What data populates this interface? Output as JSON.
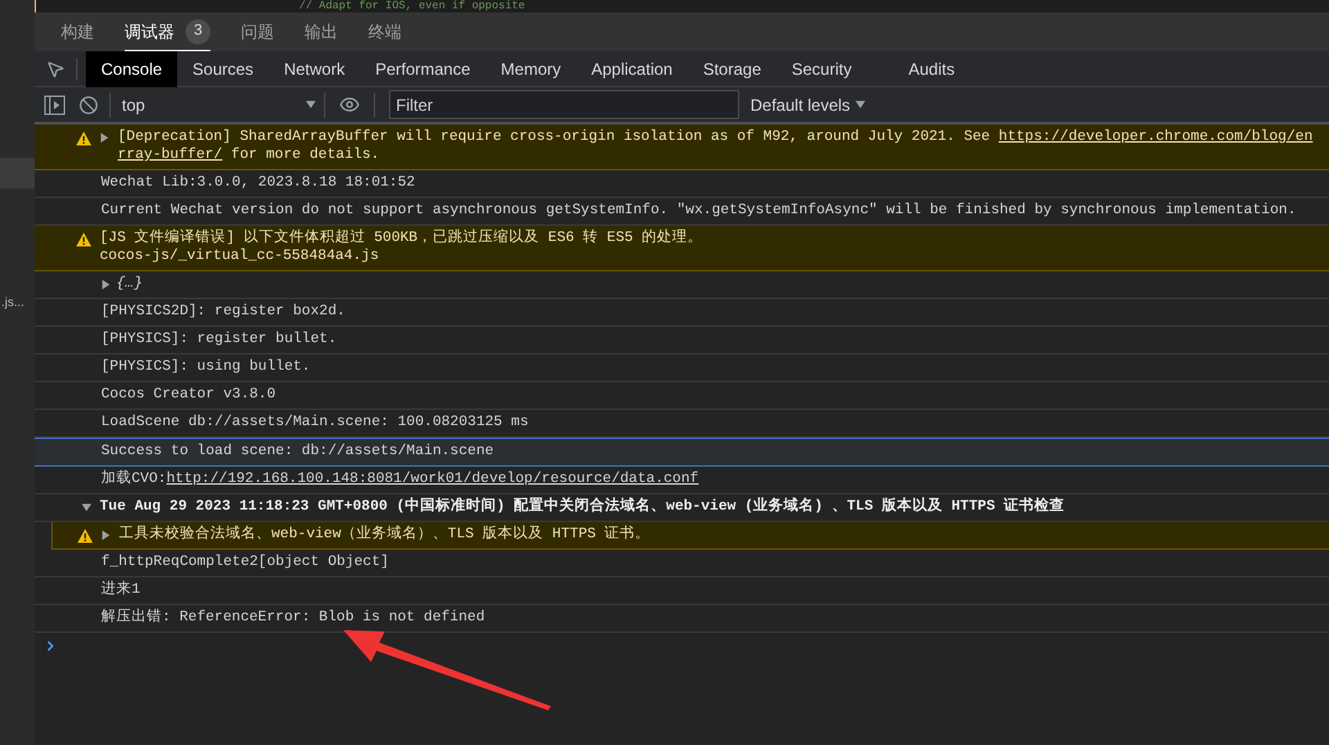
{
  "editor_line": "// Adapt for IOS, even if opposite",
  "sidebar": {
    "file_label": ".js..."
  },
  "panel_tabs": [
    {
      "label": "构建",
      "selected": false
    },
    {
      "label": "调试器",
      "selected": true,
      "badge": "3"
    },
    {
      "label": "问题",
      "selected": false
    },
    {
      "label": "输出",
      "selected": false
    },
    {
      "label": "终端",
      "selected": false
    }
  ],
  "devtools_tabs": [
    {
      "label": "Console",
      "selected": true
    },
    {
      "label": "Sources",
      "selected": false
    },
    {
      "label": "Network",
      "selected": false
    },
    {
      "label": "Performance",
      "selected": false
    },
    {
      "label": "Memory",
      "selected": false
    },
    {
      "label": "Application",
      "selected": false
    },
    {
      "label": "Storage",
      "selected": false
    },
    {
      "label": "Security",
      "selected": false
    },
    {
      "label": "Audits",
      "selected": false
    }
  ],
  "toolbar": {
    "context": "top",
    "filter_placeholder": "Filter",
    "levels": "Default levels"
  },
  "messages": [
    {
      "kind": "warning",
      "selected": false,
      "expandable": true,
      "lines": [
        [
          {
            "text": "[Deprecation] SharedArrayBuffer will require cross-origin isolation as of M92, around July 2021. See ",
            "link": false
          },
          {
            "text": "https://developer.chrome.com/blog/en",
            "link": true
          }
        ],
        [
          {
            "text": "rray-buffer/",
            "link": true
          },
          {
            "text": " for more details.",
            "link": false
          }
        ]
      ]
    },
    {
      "kind": "log",
      "selected": false,
      "lines": [
        [
          {
            "text": "Wechat Lib:3.0.0, 2023.8.18 18:01:52",
            "link": false
          }
        ]
      ]
    },
    {
      "kind": "log",
      "selected": false,
      "lines": [
        [
          {
            "text": "Current Wechat version do not support asynchronous getSystemInfo. \"wx.getSystemInfoAsync\" will be finished by synchronous implementation.",
            "link": false
          }
        ]
      ]
    },
    {
      "kind": "warning",
      "selected": false,
      "expandable": false,
      "lines": [
        [
          {
            "text": "[JS 文件编译错误] 以下文件体积超过 500KB，已跳过压缩以及 ES6 转 ES5 的处理。",
            "link": false
          }
        ],
        [
          {
            "text": "cocos-js/_virtual_cc-558484a4.js",
            "link": false
          }
        ]
      ]
    },
    {
      "kind": "object",
      "selected": false,
      "expanded": false,
      "lines": [
        [
          {
            "text": "{…}",
            "link": false
          }
        ]
      ]
    },
    {
      "kind": "log",
      "selected": false,
      "lines": [
        [
          {
            "text": "[PHYSICS2D]: register box2d.",
            "link": false
          }
        ]
      ]
    },
    {
      "kind": "log",
      "selected": false,
      "lines": [
        [
          {
            "text": "[PHYSICS]: register bullet.",
            "link": false
          }
        ]
      ]
    },
    {
      "kind": "log",
      "selected": false,
      "lines": [
        [
          {
            "text": "[PHYSICS]: using bullet.",
            "link": false
          }
        ]
      ]
    },
    {
      "kind": "log",
      "selected": false,
      "lines": [
        [
          {
            "text": "Cocos Creator v3.8.0",
            "link": false
          }
        ]
      ]
    },
    {
      "kind": "log",
      "selected": false,
      "lines": [
        [
          {
            "text": "LoadScene db://assets/Main.scene: 100.08203125 ms",
            "link": false
          }
        ]
      ]
    },
    {
      "kind": "log",
      "selected": true,
      "lines": [
        [
          {
            "text": "Success to load scene: db://assets/Main.scene",
            "link": false
          }
        ]
      ]
    },
    {
      "kind": "log",
      "selected": false,
      "lines": [
        [
          {
            "text": "加载CVO:",
            "link": false
          },
          {
            "text": "http://192.168.100.148:8081/work01/develop/resource/data.conf",
            "link": true
          }
        ]
      ]
    },
    {
      "kind": "group",
      "selected": false,
      "expanded": true,
      "lines": [
        [
          {
            "text": "Tue Aug 29 2023 11:18:23 GMT+0800 (中国标准时间) 配置中关闭合法域名、web-view (业务域名) 、TLS 版本以及 HTTPS 证书检查",
            "link": false
          }
        ]
      ],
      "children": [
        {
          "kind": "warning",
          "selected": false,
          "expandable": true,
          "lines": [
            [
              {
                "text": "工具未校验合法域名、web-view（业务域名）、TLS 版本以及 HTTPS 证书。",
                "link": false
              }
            ]
          ]
        }
      ]
    },
    {
      "kind": "log",
      "selected": false,
      "lines": [
        [
          {
            "text": "f_httpReqComplete2[object Object]",
            "link": false
          }
        ]
      ]
    },
    {
      "kind": "log",
      "selected": false,
      "lines": [
        [
          {
            "text": "进来1",
            "link": false
          }
        ]
      ]
    },
    {
      "kind": "log",
      "selected": false,
      "lines": [
        [
          {
            "text": "解压出错: ReferenceError: Blob is not defined",
            "link": false
          }
        ]
      ]
    }
  ]
}
